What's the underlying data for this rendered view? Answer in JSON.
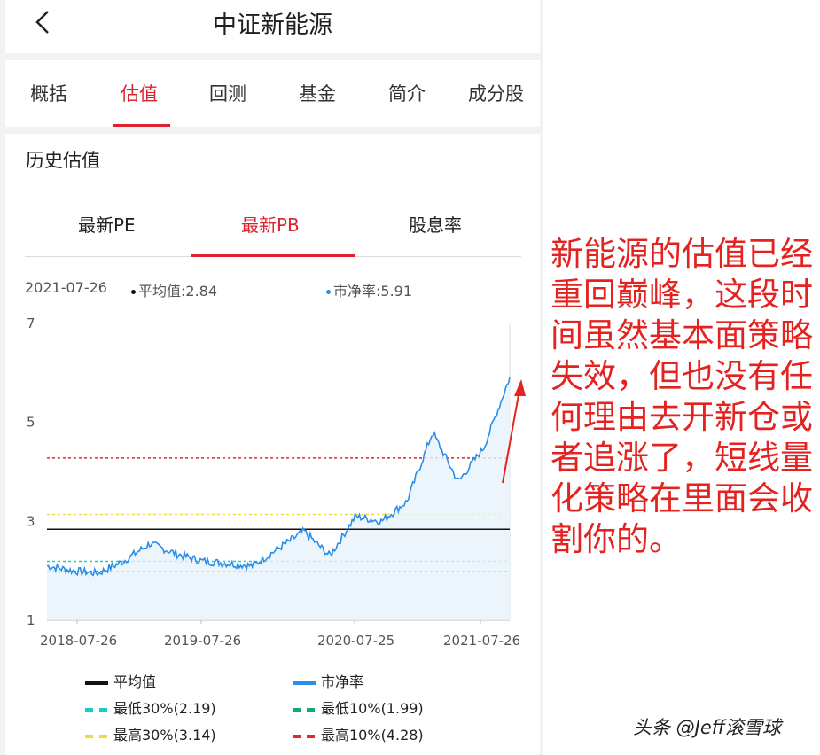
{
  "header": {
    "title": "中证新能源"
  },
  "tabs": [
    {
      "label": "概括",
      "active": false
    },
    {
      "label": "估值",
      "active": true
    },
    {
      "label": "回测",
      "active": false
    },
    {
      "label": "基金",
      "active": false
    },
    {
      "label": "简介",
      "active": false
    },
    {
      "label": "成分股",
      "active": false
    }
  ],
  "section": {
    "title": "历史估值"
  },
  "subtabs": [
    {
      "label": "最新PE",
      "active": false
    },
    {
      "label": "最新PB",
      "active": true
    },
    {
      "label": "股息率",
      "active": false
    }
  ],
  "info": {
    "date": "2021-07-26",
    "avg": "平均值:2.84",
    "pb": "市净率:5.91"
  },
  "legend": [
    {
      "label": "平均值",
      "color": "#111111",
      "style": "solid"
    },
    {
      "label": "市净率",
      "color": "#2b8ee8",
      "style": "solid"
    },
    {
      "label": "最低30%(2.19)",
      "color": "#1ec9c9",
      "style": "dashed"
    },
    {
      "label": "最低10%(1.99)",
      "color": "#16a86b",
      "style": "dashed"
    },
    {
      "label": "最高30%(3.14)",
      "color": "#e8df3a",
      "style": "dashed"
    },
    {
      "label": "最高10%(4.28)",
      "color": "#e3262e",
      "style": "dashed"
    }
  ],
  "annotation": "新能源的估值已经重回巅峰，这段时间虽然基本面策略失效，但也没有任何理由去开新仓或者追涨了，短线量化策略在里面会收割你的。",
  "watermark": "头条 @Jeff滚雪球",
  "chart_data": {
    "type": "line",
    "title": "",
    "xlabel": "",
    "ylabel": "",
    "ylim": [
      1,
      7
    ],
    "yticks": [
      "1",
      "3",
      "5",
      "7"
    ],
    "xticks": [
      "2018-07-26",
      "2019-07-26",
      "2020-07-25",
      "2021-07-26"
    ],
    "x": [
      "2018-07",
      "2018-09",
      "2018-11",
      "2019-01",
      "2019-03",
      "2019-05",
      "2019-07",
      "2019-09",
      "2019-11",
      "2020-01",
      "2020-03",
      "2020-05",
      "2020-07",
      "2020-09",
      "2020-11",
      "2021-01",
      "2021-03",
      "2021-05",
      "2021-07"
    ],
    "series": [
      {
        "name": "市净率",
        "values": [
          2.1,
          2.0,
          1.95,
          2.2,
          2.55,
          2.35,
          2.2,
          2.15,
          2.1,
          2.45,
          2.8,
          2.3,
          3.1,
          3.0,
          3.4,
          4.8,
          3.8,
          4.5,
          5.91
        ]
      },
      {
        "name": "平均值",
        "values": [
          2.84,
          2.84,
          2.84,
          2.84,
          2.84,
          2.84,
          2.84,
          2.84,
          2.84,
          2.84,
          2.84,
          2.84,
          2.84,
          2.84,
          2.84,
          2.84,
          2.84,
          2.84,
          2.84
        ]
      }
    ],
    "reference_lines": [
      {
        "name": "最低30%",
        "value": 2.19
      },
      {
        "name": "最低10%",
        "value": 1.99
      },
      {
        "name": "最高30%",
        "value": 3.14
      },
      {
        "name": "最高10%",
        "value": 4.28
      }
    ],
    "grid": false,
    "legend": "bottom"
  }
}
